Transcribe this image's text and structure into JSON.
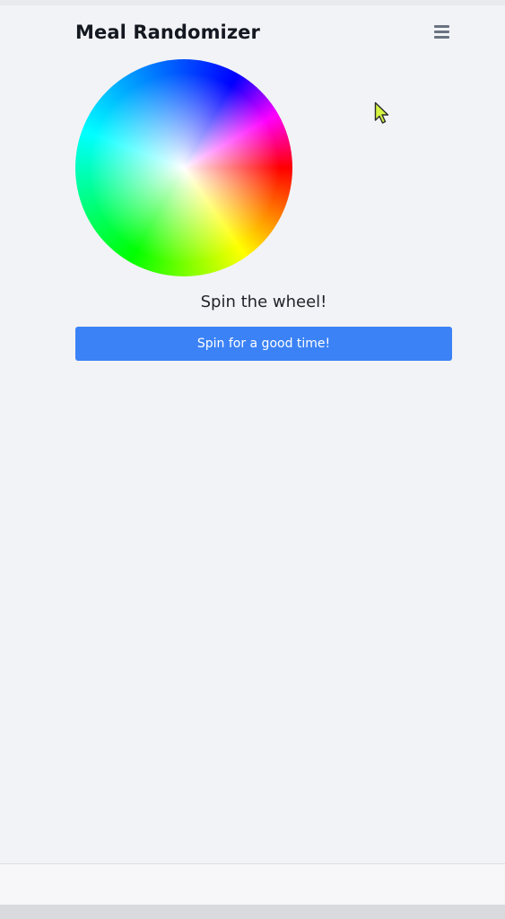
{
  "header": {
    "title": "Meal Randomizer",
    "menu_icon": "hamburger-menu-icon"
  },
  "wheel": {
    "icon": "color-wheel",
    "colors": [
      "#ff0000",
      "#ffff00",
      "#00ff00",
      "#00ffff",
      "#0000ff",
      "#ff00ff"
    ]
  },
  "main": {
    "status_text": "Spin the wheel!",
    "spin_button_label": "Spin for a good time!"
  },
  "theme": {
    "background": "#f2f3f6",
    "accent": "#3b82f6",
    "title_color": "#141820"
  }
}
